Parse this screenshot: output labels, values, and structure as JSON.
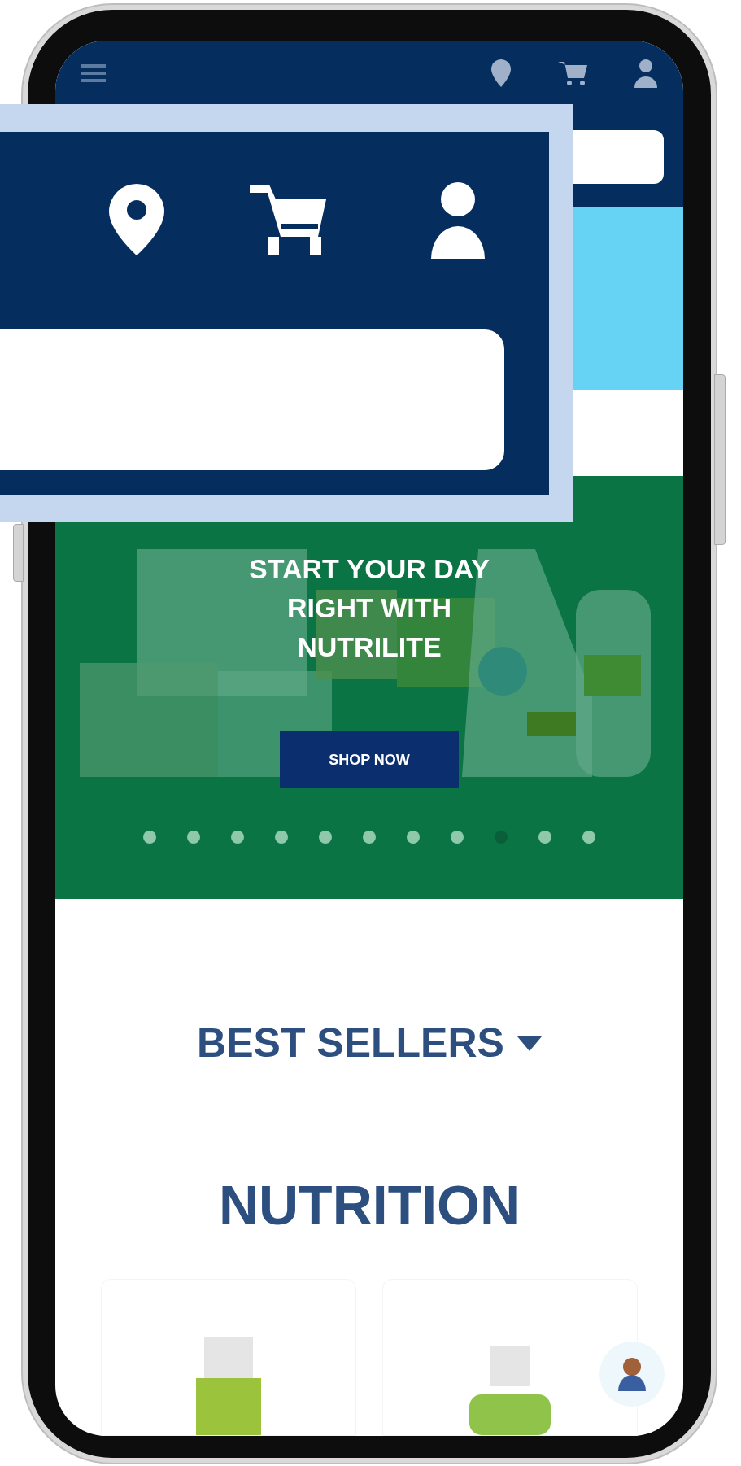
{
  "banner": {
    "headline": "START YOUR DAY RIGHT WITH NUTRILITE",
    "button": "SHOP NOW",
    "dots": [
      {
        "selected": false
      },
      {
        "selected": false
      },
      {
        "selected": false
      },
      {
        "selected": false
      },
      {
        "selected": false
      },
      {
        "selected": false
      },
      {
        "selected": false
      },
      {
        "selected": false
      },
      {
        "selected": true
      },
      {
        "selected": false
      },
      {
        "selected": false
      }
    ]
  },
  "sections": [
    {
      "title": "BEST SELLERS",
      "expandable": true
    },
    {
      "title": "NUTRITION",
      "expandable": false
    }
  ]
}
